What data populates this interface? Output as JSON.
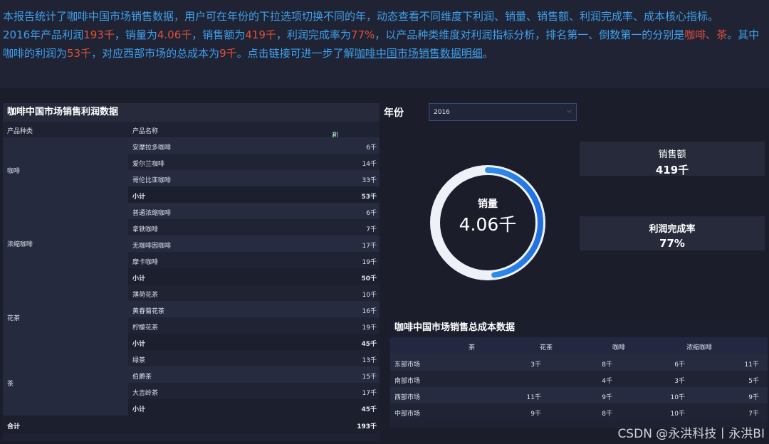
{
  "summary": {
    "line1": "本报告统计了咖啡中国市场销售数据，用户可在年份的下拉选项切换不同的年，动态查看不同维度下利润、销量、销售额、利润完成率、成本核心指标。",
    "p1": "2016年产品利润",
    "profit": "193千",
    "p2": "，销量为",
    "volume": "4.06千",
    "p3": "，销售额为",
    "sales": "419千",
    "p4": "，利润完成率为",
    "rate": "77%",
    "p5": "，以产品种类维度对利润指标分析，排名第一、倒数第一的分别是",
    "top_bottom": "咖啡、茶",
    "p6": "。其中咖啡的利润为",
    "coffee_profit": "53千",
    "p7": "，对应西部市场的总成本为",
    "west_cost": "9千",
    "p8": "。点击链接可进一步了解",
    "link_text": "咖啡中国市场销售数据明细",
    "p9": "。"
  },
  "profit_table": {
    "title": "咖啡中国市场销售利润数据",
    "col_category": "产品种类",
    "col_product": "产品名称",
    "col_profit": "利润_总和",
    "sort_icon": "arrow-up-icon",
    "categories": [
      {
        "name": "咖啡",
        "rows": [
          {
            "name": "安摩拉多咖啡",
            "value": "6千"
          },
          {
            "name": "爱尔兰咖啡",
            "value": "14千"
          },
          {
            "name": "哥伦比亚咖啡",
            "value": "33千"
          },
          {
            "name": "小计",
            "value": "53千",
            "subtotal": true
          }
        ]
      },
      {
        "name": "浓缩咖啡",
        "rows": [
          {
            "name": "普通浓缩咖啡",
            "value": "6千"
          },
          {
            "name": "拿铁咖啡",
            "value": "7千"
          },
          {
            "name": "无咖啡因咖啡",
            "value": "17千"
          },
          {
            "name": "摩卡咖啡",
            "value": "19千"
          },
          {
            "name": "小计",
            "value": "50千",
            "subtotal": true
          }
        ]
      },
      {
        "name": "花茶",
        "rows": [
          {
            "name": "薄荷花茶",
            "value": "10千"
          },
          {
            "name": "黄春菊花茶",
            "value": "16千"
          },
          {
            "name": "柠檬花茶",
            "value": "19千"
          },
          {
            "name": "小计",
            "value": "45千",
            "subtotal": true
          }
        ]
      },
      {
        "name": "茶",
        "rows": [
          {
            "name": "绿茶",
            "value": "13千"
          },
          {
            "name": "伯爵茶",
            "value": "15千"
          },
          {
            "name": "大吉岭茶",
            "value": "17千"
          },
          {
            "name": "小计",
            "value": "45千",
            "subtotal": true
          }
        ]
      }
    ],
    "total_label": "合计",
    "total_value": "193千"
  },
  "filter": {
    "label": "年份",
    "value": "2016",
    "icon": "chevron-down-icon"
  },
  "gauge": {
    "title": "销量",
    "value": "4.06千",
    "fraction": 0.48,
    "track_color": "#eef1f8",
    "arc_start_color": "#3fb0f5",
    "arc_end_color": "#1f6fe0"
  },
  "kpis": {
    "sales": {
      "label": "销售额",
      "value": "419千"
    },
    "rate": {
      "label": "利润完成率",
      "value": "77%"
    }
  },
  "cost_table": {
    "title": "咖啡中国市场销售总成本数据",
    "headers": [
      "",
      "茶",
      "花茶",
      "咖啡",
      "浓缩咖啡"
    ],
    "rows": [
      {
        "market": "东部市场",
        "values": [
          "3千",
          "8千",
          "6千",
          "11千"
        ]
      },
      {
        "market": "南部市场",
        "values": [
          "",
          "4千",
          "3千",
          "5千"
        ]
      },
      {
        "market": "西部市场",
        "values": [
          "11千",
          "9千",
          "10千",
          "9千"
        ]
      },
      {
        "market": "中部市场",
        "values": [
          "9千",
          "8千",
          "10千",
          "7千"
        ]
      }
    ]
  },
  "watermark": "CSDN @永洪科技丨永洪BI",
  "colors": {
    "highlight": "#e0503c",
    "text_accent": "#3fa0ee",
    "background": "#1b1d2b"
  }
}
